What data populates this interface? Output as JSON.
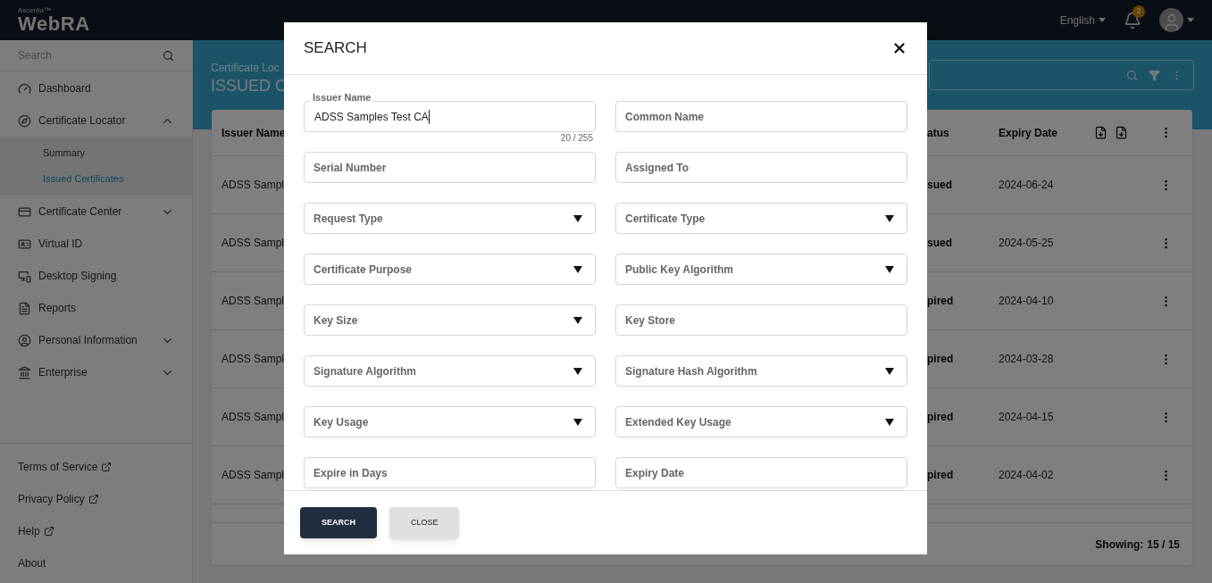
{
  "header": {
    "brand_small": "Ascertia™",
    "brand": "WebRA",
    "language": "English",
    "notifications": "2"
  },
  "sidebar": {
    "search": {
      "placeholder": "Search"
    },
    "items": [
      {
        "kind": "link",
        "label": "Dashboard"
      },
      {
        "kind": "group",
        "label": "Certificate Locator",
        "expanded": true,
        "children": [
          {
            "label": "Summary",
            "selected": false
          },
          {
            "label": "Issued Certificates",
            "selected": true
          }
        ]
      },
      {
        "kind": "group",
        "label": "Certificate Center",
        "expanded": false
      },
      {
        "kind": "link",
        "label": "Virtual ID"
      },
      {
        "kind": "link",
        "label": "Desktop Signing"
      },
      {
        "kind": "link",
        "label": "Reports"
      },
      {
        "kind": "group",
        "label": "Personal Information",
        "expanded": false
      },
      {
        "kind": "group",
        "label": "Enterprise",
        "expanded": false
      }
    ],
    "footer_links": [
      {
        "label": "Terms of Service",
        "external": true
      },
      {
        "label": "Privacy Policy",
        "external": true
      },
      {
        "label": "Help",
        "external": true
      },
      {
        "label": "About",
        "external": false
      }
    ]
  },
  "page": {
    "breadcrumb": "Certificate Loc",
    "title": "ISSUED C"
  },
  "table": {
    "columns": [
      "Issuer Name",
      "atus",
      "Expiry Date"
    ],
    "rows": [
      [
        "ADSS Sampl",
        "sued",
        "2024-06-24"
      ],
      [
        "ADSS Sampl",
        "sued",
        "2024-05-25"
      ],
      [
        "ADSS Sampl",
        "pired",
        "2024-04-10"
      ],
      [
        "ADSS Sampl",
        "pired",
        "2024-03-28"
      ],
      [
        "ADSS Sampl",
        "pired",
        "2024-04-15"
      ],
      [
        "ADSS Sampl",
        "pired",
        "2024-04-02"
      ]
    ],
    "showing_label": "Showing:",
    "showing_value": "15 / 15"
  },
  "modal": {
    "title": "SEARCH",
    "fields": [
      {
        "kind": "text",
        "label": "Issuer Name",
        "value": "ADSS Samples Test CA",
        "counter": "20 / 255"
      },
      {
        "kind": "text",
        "label": "Common Name"
      },
      {
        "kind": "text",
        "label": "Serial Number"
      },
      {
        "kind": "text",
        "label": "Assigned To"
      },
      {
        "kind": "select",
        "label": "Request Type"
      },
      {
        "kind": "select",
        "label": "Certificate Type"
      },
      {
        "kind": "select",
        "label": "Certificate Purpose"
      },
      {
        "kind": "select",
        "label": "Public Key Algorithm"
      },
      {
        "kind": "select",
        "label": "Key Size"
      },
      {
        "kind": "text",
        "label": "Key Store"
      },
      {
        "kind": "select",
        "label": "Signature Algorithm"
      },
      {
        "kind": "select",
        "label": "Signature Hash Algorithm"
      },
      {
        "kind": "select",
        "label": "Key Usage"
      },
      {
        "kind": "select",
        "label": "Extended Key Usage"
      },
      {
        "kind": "text",
        "label": "Expire in Days"
      },
      {
        "kind": "text",
        "label": "Expiry Date"
      }
    ],
    "buttons": [
      {
        "kind": "primary",
        "label": "SEARCH"
      },
      {
        "kind": "secondary",
        "label": "CLOSE"
      }
    ]
  }
}
